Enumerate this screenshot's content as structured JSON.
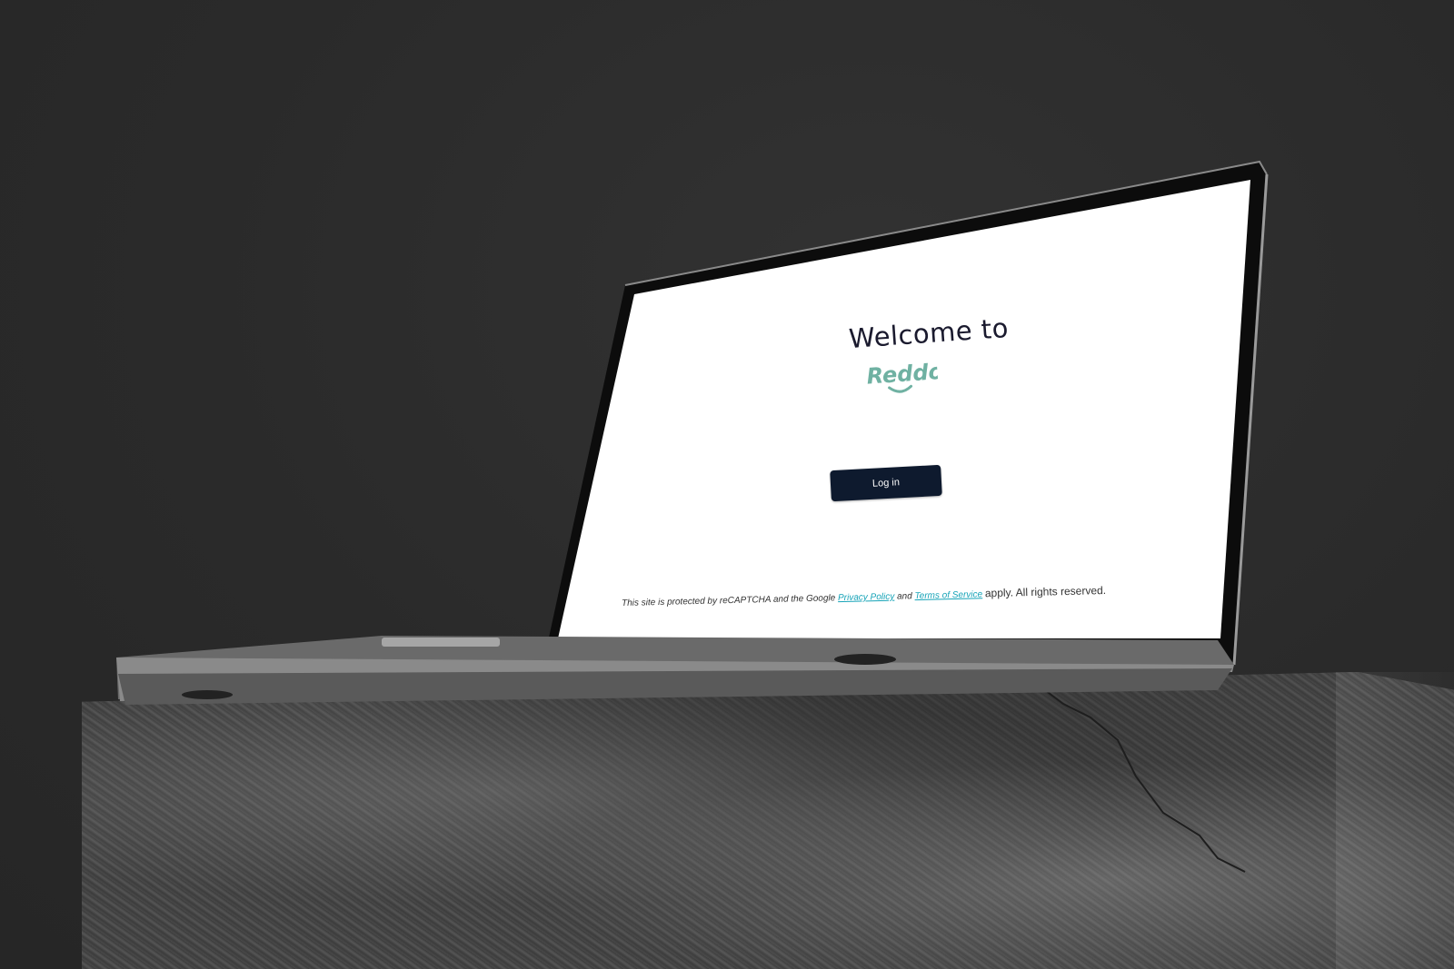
{
  "screen": {
    "welcome_text": "Welcome to",
    "brand_name": "Reddo",
    "login_button_label": "Log in",
    "footer": {
      "prefix": "This site is protected by reCAPTCHA and the Google",
      "privacy_link": "Privacy Policy",
      "and_text": "and",
      "terms_link": "Terms of Service",
      "suffix": "apply. All rights reserved."
    }
  },
  "colors": {
    "brand_teal": "#6fb1a2",
    "button_navy": "#0e1a2e",
    "link_cyan": "#17a4b8",
    "background": "#2b2b2b"
  }
}
